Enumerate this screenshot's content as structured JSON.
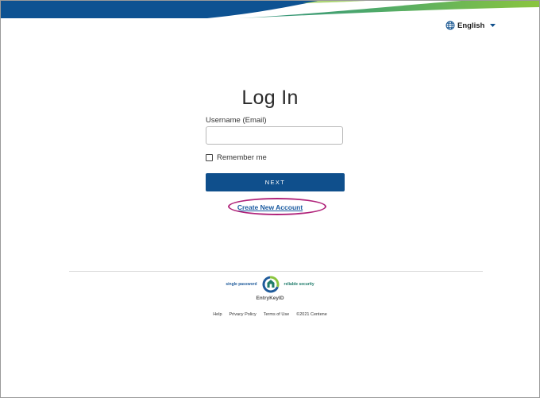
{
  "header": {
    "language_label": "English",
    "language_icon": "globe-icon",
    "caret_icon": "caret-down-icon"
  },
  "login": {
    "title": "Log In",
    "username_label": "Username (Email)",
    "username_value": "",
    "username_placeholder": "",
    "remember_label": "Remember me",
    "remember_checked": false,
    "next_label": "NEXT",
    "create_account_label": "Create New Account"
  },
  "brand": {
    "tagline_left": "single password",
    "tagline_right": "reliable security",
    "name": "EntryKeyID"
  },
  "footer": {
    "help": "Help",
    "privacy": "Privacy Policy",
    "terms": "Terms of Use",
    "copyright": "©2021 Centene"
  },
  "colors": {
    "primary": "#0f4f8c",
    "banner_dark": "#0d5292",
    "banner_teal": "#2f8f7f",
    "banner_green": "#8bc53f",
    "highlight": "#b0237a",
    "link": "#1a5aa0"
  }
}
